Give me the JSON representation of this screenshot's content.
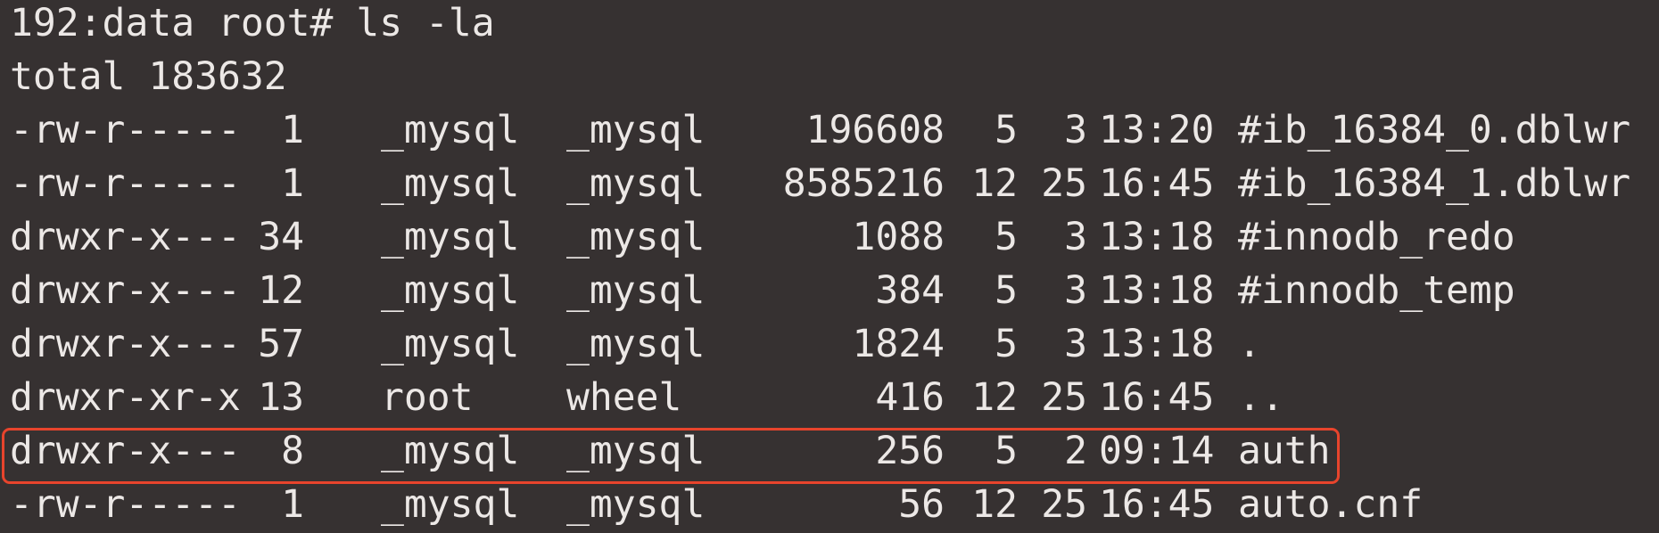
{
  "terminal": {
    "background": "#363131",
    "foreground": "#ece8e6",
    "highlight_color": "#e8442c",
    "command_line": "192:data root# ls -la",
    "total_line": "total 183632",
    "rows": [
      {
        "perms": "-rw-r-----",
        "links": "1",
        "owner": "_mysql",
        "group": "_mysql",
        "size": "196608",
        "month": "5",
        "day": "3",
        "time": "13:20",
        "name": "#ib_16384_0.dblwr"
      },
      {
        "perms": "-rw-r-----",
        "links": "1",
        "owner": "_mysql",
        "group": "_mysql",
        "size": "8585216",
        "month": "12",
        "day": "25",
        "time": "16:45",
        "name": "#ib_16384_1.dblwr"
      },
      {
        "perms": "drwxr-x---",
        "links": "34",
        "owner": "_mysql",
        "group": "_mysql",
        "size": "1088",
        "month": "5",
        "day": "3",
        "time": "13:18",
        "name": "#innodb_redo"
      },
      {
        "perms": "drwxr-x---",
        "links": "12",
        "owner": "_mysql",
        "group": "_mysql",
        "size": "384",
        "month": "5",
        "day": "3",
        "time": "13:18",
        "name": "#innodb_temp"
      },
      {
        "perms": "drwxr-x---",
        "links": "57",
        "owner": "_mysql",
        "group": "_mysql",
        "size": "1824",
        "month": "5",
        "day": "3",
        "time": "13:18",
        "name": "."
      },
      {
        "perms": "drwxr-xr-x",
        "links": "13",
        "owner": "root",
        "group": "wheel",
        "size": "416",
        "month": "12",
        "day": "25",
        "time": "16:45",
        "name": ".."
      },
      {
        "perms": "drwxr-x---",
        "links": "8",
        "owner": "_mysql",
        "group": "_mysql",
        "size": "256",
        "month": "5",
        "day": "2",
        "time": "09:14",
        "name": "auth"
      },
      {
        "perms": "-rw-r-----",
        "links": "1",
        "owner": "_mysql",
        "group": "_mysql",
        "size": "56",
        "month": "12",
        "day": "25",
        "time": "16:45",
        "name": "auto.cnf"
      }
    ]
  }
}
